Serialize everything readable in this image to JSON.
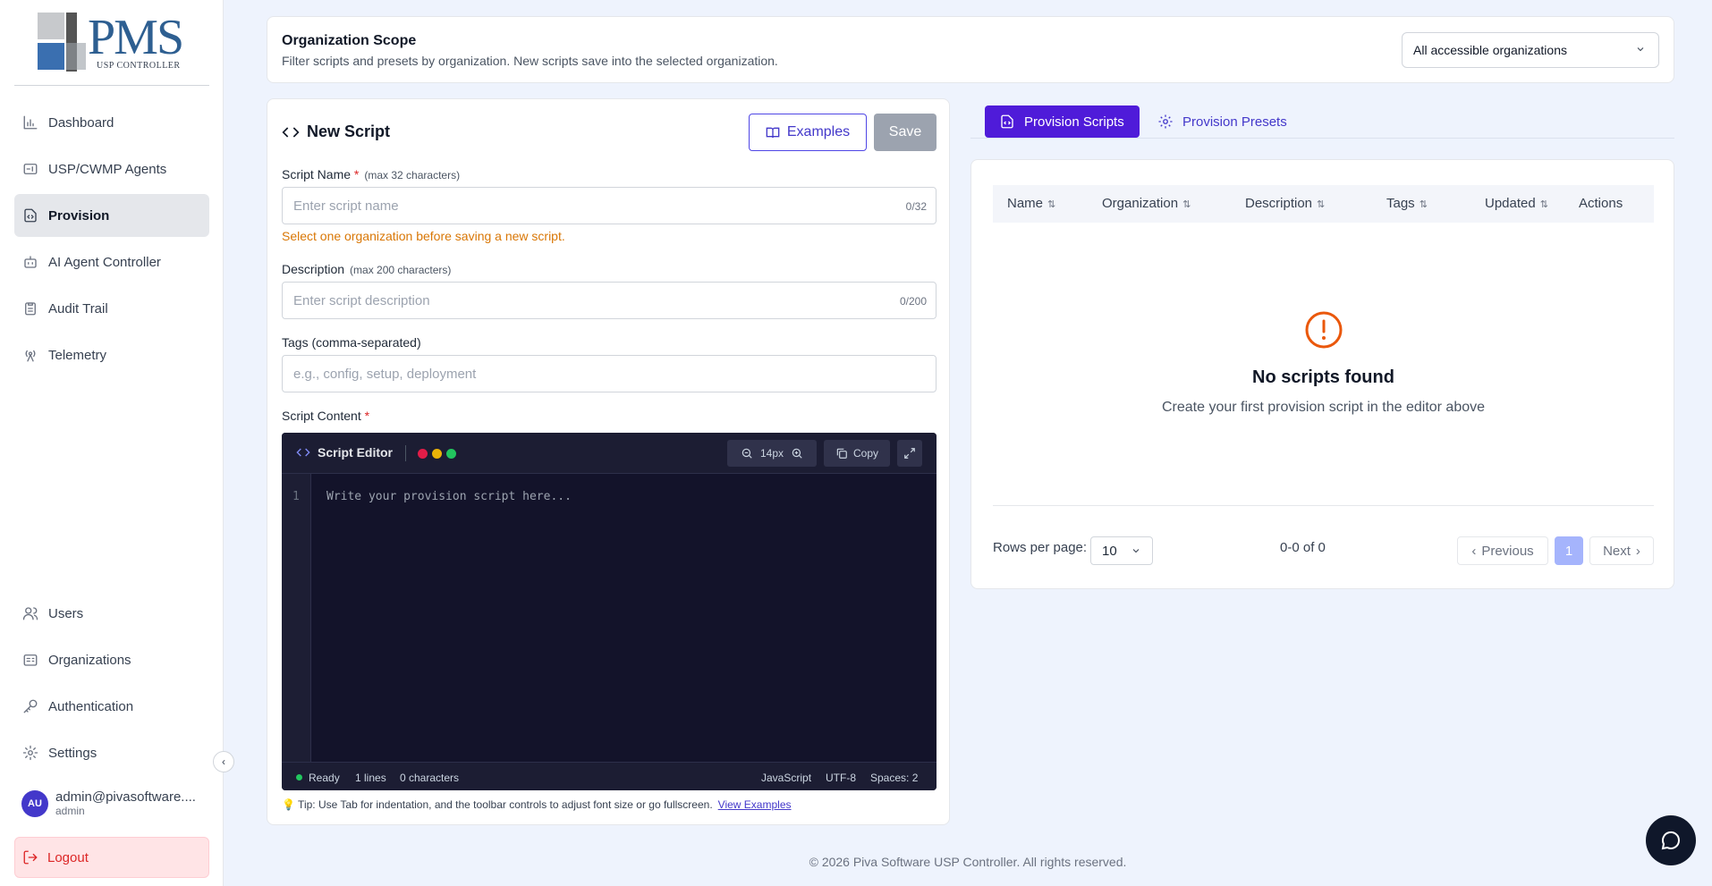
{
  "logo": {
    "text": "PMS",
    "sub": "USP CONTROLLER"
  },
  "sidebar": {
    "items": [
      {
        "label": "Dashboard",
        "icon": "bar-chart-icon"
      },
      {
        "label": "USP/CWMP Agents",
        "icon": "router-icon"
      },
      {
        "label": "Provision",
        "icon": "file-code-icon",
        "active": true
      },
      {
        "label": "AI Agent Controller",
        "icon": "bot-icon"
      },
      {
        "label": "Audit Trail",
        "icon": "clipboard-icon"
      },
      {
        "label": "Telemetry",
        "icon": "radio-tower-icon"
      }
    ],
    "bottom_items": [
      {
        "label": "Users",
        "icon": "users-icon"
      },
      {
        "label": "Organizations",
        "icon": "building-icon"
      },
      {
        "label": "Authentication",
        "icon": "key-icon"
      },
      {
        "label": "Settings",
        "icon": "gear-icon"
      }
    ],
    "user": {
      "initials": "AU",
      "email": "admin@pivasoftware....",
      "role": "admin"
    },
    "logout": "Logout"
  },
  "scope": {
    "title": "Organization Scope",
    "description": "Filter scripts and presets by organization. New scripts save into the selected organization.",
    "selected": "All accessible organizations"
  },
  "editor": {
    "title": "New Script",
    "examples_label": "Examples",
    "save_label": "Save",
    "name_label": "Script Name",
    "name_hint": "(max 32 characters)",
    "name_placeholder": "Enter script name",
    "name_counter": "0/32",
    "org_warning": "Select one organization before saving a new script.",
    "desc_label": "Description",
    "desc_hint": "(max 200 characters)",
    "desc_placeholder": "Enter script description",
    "desc_counter": "0/200",
    "tags_label": "Tags (comma-separated)",
    "tags_placeholder": "e.g., config, setup, deployment",
    "content_label": "Script Content",
    "code": {
      "title": "Script Editor",
      "font_size": "14px",
      "copy_label": "Copy",
      "line_number": "1",
      "placeholder": "Write your provision script here...",
      "status": "Ready",
      "lines": "1 lines",
      "chars": "0 characters",
      "language": "JavaScript",
      "encoding": "UTF-8",
      "spaces": "Spaces: 2",
      "dot_colors": [
        "#e11d48",
        "#eab308",
        "#22c55e"
      ]
    },
    "tip": "💡 Tip: Use Tab for indentation, and the toolbar controls to adjust font size or go fullscreen.",
    "tip_link": "View Examples"
  },
  "tabs": [
    {
      "label": "Provision Scripts",
      "icon": "file-code-icon",
      "active": true
    },
    {
      "label": "Provision Presets",
      "icon": "gear-icon",
      "active": false
    }
  ],
  "table": {
    "columns": [
      "Name",
      "Organization",
      "Description",
      "Tags",
      "Updated",
      "Actions"
    ],
    "empty_title": "No scripts found",
    "empty_subtitle": "Create your first provision script in the editor above",
    "rows_per_page_label": "Rows per page:",
    "rows_per_page": "10",
    "range": "0-0 of 0",
    "prev": "Previous",
    "page": "1",
    "next": "Next"
  },
  "footer": "© 2026 Piva Software USP Controller. All rights reserved.",
  "colors": {
    "accent": "#4f1bd9",
    "warning": "#d97706",
    "editor_bg": "#13132a"
  }
}
